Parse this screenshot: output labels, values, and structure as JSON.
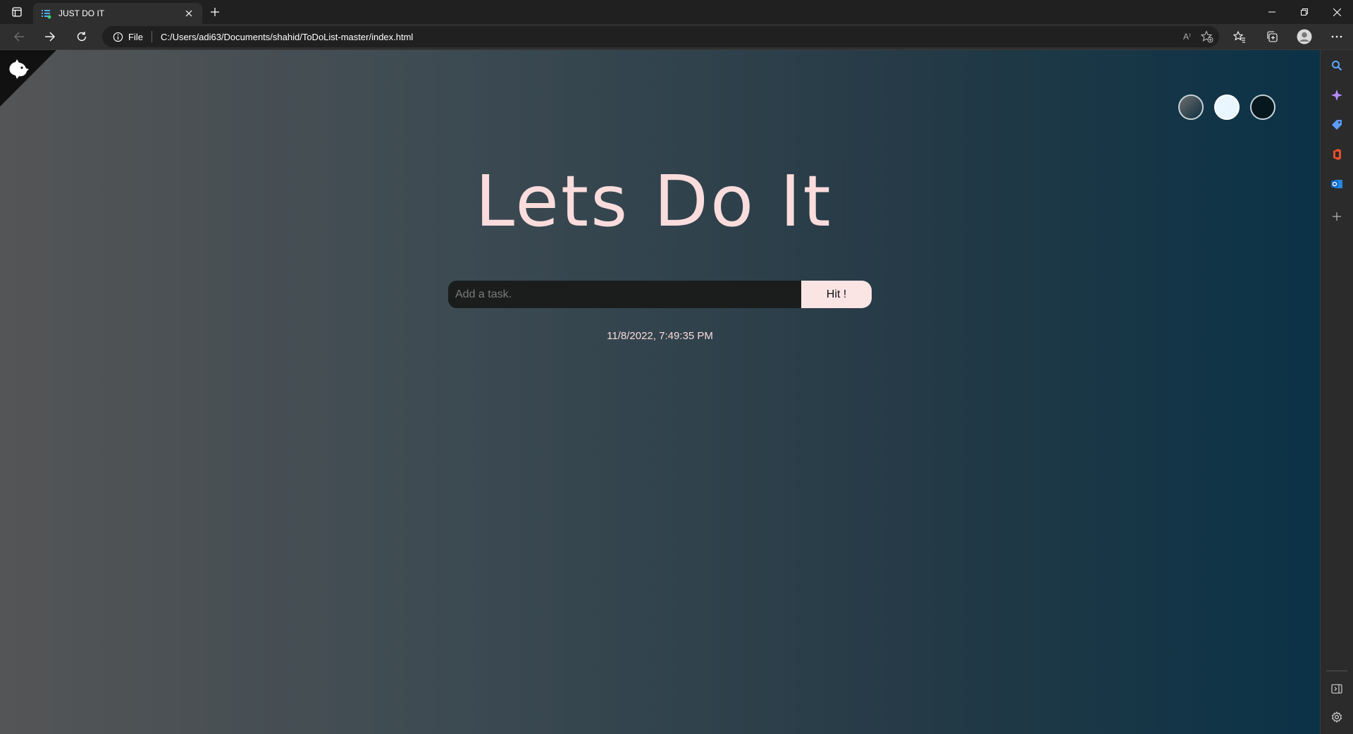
{
  "browser": {
    "tab": {
      "title": "JUST DO IT"
    },
    "address": {
      "site_label": "File",
      "url": "C:/Users/adi63/Documents/shahid/ToDoList-master/index.html"
    },
    "read_aloud_glyph": "A⁾"
  },
  "page": {
    "heading": "Lets Do It",
    "input_placeholder": "Add a task.",
    "submit_label": "Hit !",
    "datetime": "11/8/2022, 7:49:35 PM",
    "colors": {
      "accent": "#fbdcdc",
      "input_bg": "#1b1d1d",
      "gradient_left": "#545556",
      "gradient_right": "#0b3247"
    }
  },
  "sidebar": {
    "icons": [
      "search-icon",
      "copilot-icon",
      "shopping-tag-icon",
      "office-icon",
      "outlook-icon",
      "add-icon",
      "hide-sidebar-icon",
      "settings-icon"
    ]
  }
}
